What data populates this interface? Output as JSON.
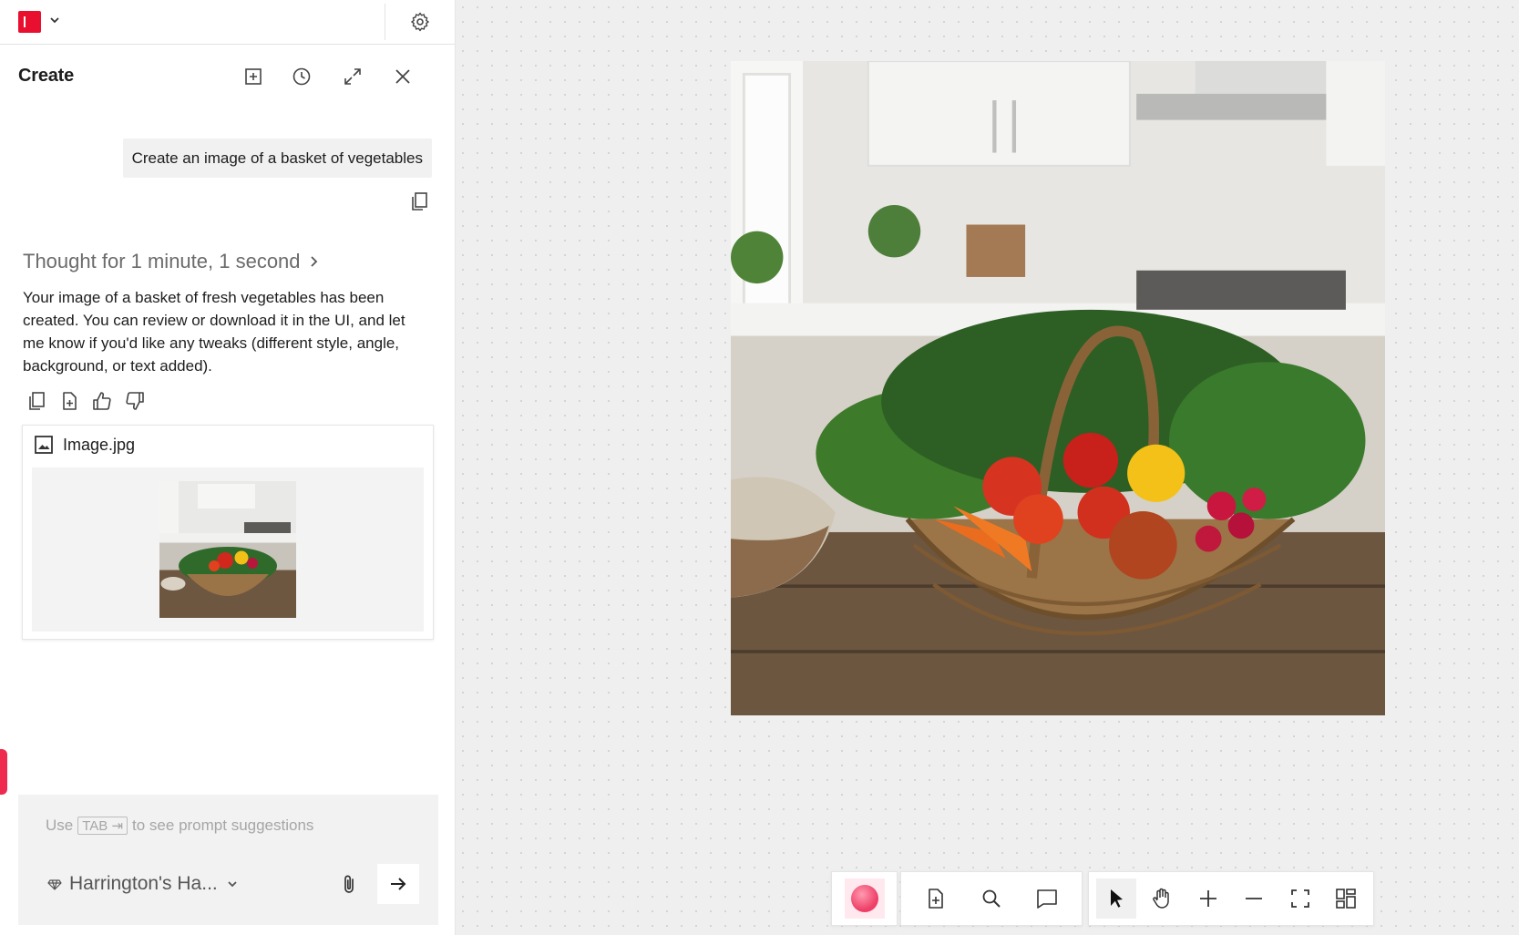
{
  "header": {
    "title": "Create"
  },
  "conversation": {
    "user_prompt": "Create an image of a basket of vegetables",
    "thought_label": "Thought for 1 minute, 1 second",
    "reply": "Your image of a basket of fresh vegetables has been created. You can review or download it in the UI, and let me know if you'd like any tweaks (different style, angle, background, or text added).",
    "attachment": {
      "filename": "Image.jpg"
    }
  },
  "composer": {
    "hint_prefix": "Use",
    "hint_key": "TAB ⇥",
    "hint_suffix": "to see prompt suggestions",
    "brand_label": "Harrington's Ha..."
  },
  "colors": {
    "brand_red": "#e8102e",
    "accent_pink": "#ee3f67"
  }
}
